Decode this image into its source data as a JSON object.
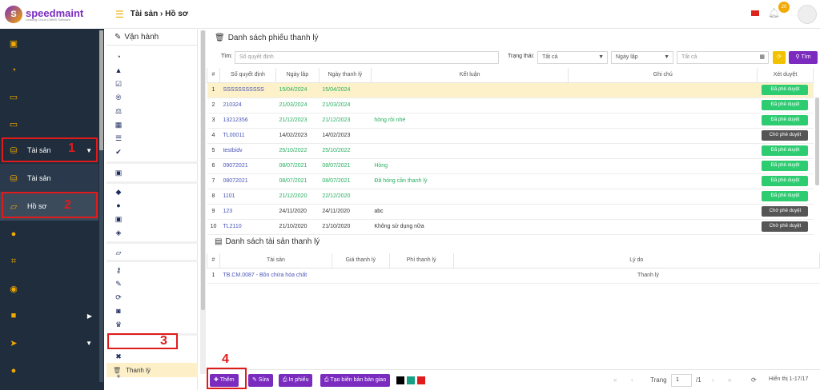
{
  "brand": {
    "name_a": "speed",
    "name_b": "maint",
    "tagline": "Leading Cloud CMMS Software",
    "mark": "S"
  },
  "colors": {
    "accent": "#f2a900",
    "purple": "#7b2cbf",
    "sidebar": "#1f2d3d",
    "approved": "#2ecc71",
    "pending": "#555555",
    "highlight": "#fdf1c9",
    "annotation": "#e01b1b"
  },
  "topbar": {
    "crumb": "Tài sản › Hồ sơ",
    "badge": "20"
  },
  "sidebar": {
    "group_label": "Tài sản",
    "sub_items": [
      "Tài sản",
      "Hồ sơ"
    ]
  },
  "mid_panel": {
    "header": "Vận hành",
    "active_item": "Thanh lý"
  },
  "list_section": {
    "title": "Danh sách phiếu thanh lý",
    "search_label": "Tìm:",
    "search_placeholder": "Số quyết định",
    "status_label": "Trạng thái:",
    "status_value": "Tất cả",
    "date_value": "Ngày lập",
    "date_range_placeholder": "Tất cả",
    "search_button": "Tìm"
  },
  "table1": {
    "headers": [
      "#",
      "Số quyết định",
      "Ngày lập",
      "Ngày thanh lý",
      "Kết luận",
      "Ghi chú",
      "Xét duyệt"
    ],
    "rows": [
      {
        "n": "1",
        "code": "SSSSSSSSSSS",
        "created": "15/04/2024",
        "liquidated": "15/04/2024",
        "conclusion": "",
        "note": "",
        "status": "Đã phê duyệt",
        "approved": true,
        "tone": "g"
      },
      {
        "n": "2",
        "code": "210324",
        "created": "21/03/2024",
        "liquidated": "21/03/2024",
        "conclusion": "",
        "note": "",
        "status": "Đã phê duyệt",
        "approved": true,
        "tone": "g"
      },
      {
        "n": "3",
        "code": "13212356",
        "created": "21/12/2023",
        "liquidated": "21/12/2023",
        "conclusion": "hỏng rồi nhé",
        "note": "",
        "status": "Đã phê duyệt",
        "approved": true,
        "tone": "g"
      },
      {
        "n": "4",
        "code": "TL00011",
        "created": "14/02/2023",
        "liquidated": "14/02/2023",
        "conclusion": "",
        "note": "",
        "status": "Chờ phê duyệt",
        "approved": false,
        "tone": "d"
      },
      {
        "n": "5",
        "code": "testbidv",
        "created": "25/10/2022",
        "liquidated": "25/10/2022",
        "conclusion": "",
        "note": "",
        "status": "Đã phê duyệt",
        "approved": true,
        "tone": "g"
      },
      {
        "n": "6",
        "code": "09072021",
        "created": "08/07/2021",
        "liquidated": "08/07/2021",
        "conclusion": "Hỏng",
        "note": "",
        "status": "Đã phê duyệt",
        "approved": true,
        "tone": "g"
      },
      {
        "n": "7",
        "code": "08072021",
        "created": "08/07/2021",
        "liquidated": "08/07/2021",
        "conclusion": "Đã hỏng cần thanh lý",
        "note": "",
        "status": "Đã phê duyệt",
        "approved": true,
        "tone": "g"
      },
      {
        "n": "8",
        "code": "1101",
        "created": "21/12/2020",
        "liquidated": "22/12/2020",
        "conclusion": "",
        "note": "",
        "status": "Đã phê duyệt",
        "approved": true,
        "tone": "g"
      },
      {
        "n": "9",
        "code": "123",
        "created": "24/11/2020",
        "liquidated": "24/11/2020",
        "conclusion": "abc",
        "note": "",
        "status": "Chờ phê duyệt",
        "approved": false,
        "tone": "d"
      },
      {
        "n": "10",
        "code": "TL2110",
        "created": "21/10/2020",
        "liquidated": "21/10/2020",
        "conclusion": "Không sử dụng nữa",
        "note": "",
        "status": "Chờ phê duyệt",
        "approved": false,
        "tone": "d"
      }
    ]
  },
  "asset_section": {
    "title": "Danh sách tài sản thanh lý",
    "headers": [
      "#",
      "Tài sản",
      "Giá thanh lý",
      "Phí thanh lý",
      "Lý do"
    ],
    "rows": [
      {
        "n": "1",
        "asset": "TB.CM.0087 - Bồn chứa hóa chất",
        "price": "",
        "fee": "",
        "reason": "Thanh lý"
      }
    ]
  },
  "toolbar": {
    "add": "Thêm",
    "edit": "Sửa",
    "print": "In phiếu",
    "handover": "Tạo biên bản bàn giao"
  },
  "pager": {
    "page_label": "Trang",
    "page": "1",
    "total": "/1",
    "summary": "Hiển thị 1-17/17"
  },
  "annotations": [
    "1",
    "2",
    "3",
    "4"
  ]
}
